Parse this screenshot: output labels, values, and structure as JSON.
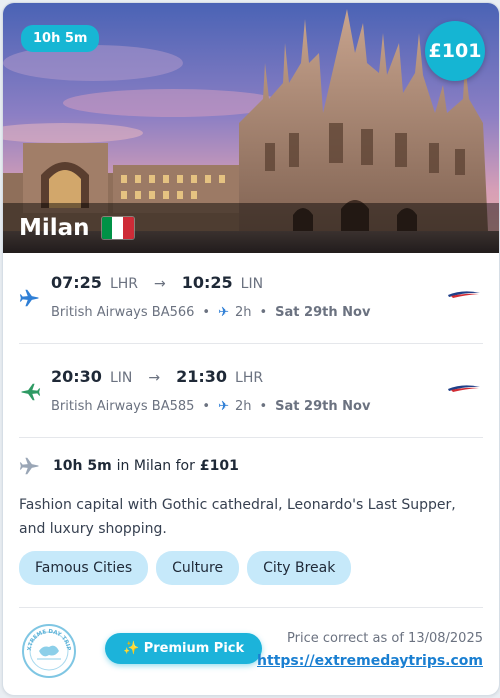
{
  "hero": {
    "duration_pill": "10h 5m",
    "price": "£101",
    "city": "Milan",
    "flag_colors": [
      "#009246",
      "#ffffff",
      "#ce2b37"
    ]
  },
  "flights": [
    {
      "dep_time": "07:25",
      "dep_airport": "LHR",
      "arr_time": "10:25",
      "arr_airport": "LIN",
      "airline": "British Airways BA566",
      "duration": "2h",
      "date": "Sat 29th Nov",
      "direction": "outbound",
      "icon": "plane-departure-icon",
      "icon_color": "#2f7fd6"
    },
    {
      "dep_time": "20:30",
      "dep_airport": "LIN",
      "arr_time": "21:30",
      "arr_airport": "LHR",
      "airline": "British Airways BA585",
      "duration": "2h",
      "date": "Sat 29th Nov",
      "direction": "return",
      "icon": "plane-return-icon",
      "icon_color": "#2e9a63"
    }
  ],
  "stay": {
    "duration": "10h 5m",
    "in_text": "in Milan for",
    "price": "£101"
  },
  "description": "Fashion capital with Gothic cathedral, Leonardo's Last Supper, and luxury shopping.",
  "tags": [
    "Famous Cities",
    "Culture",
    "City Break"
  ],
  "footer": {
    "premium_label": "✨ Premium Pick",
    "price_note": "Price correct as of 13/08/2025",
    "site_url": "https://extremedaytrips.com"
  },
  "logo_text": "EXTREME DAY TRIPS",
  "colors": {
    "accent": "#15b5d3",
    "tag_bg": "#c6e9fa",
    "link": "#1a7fd1"
  }
}
